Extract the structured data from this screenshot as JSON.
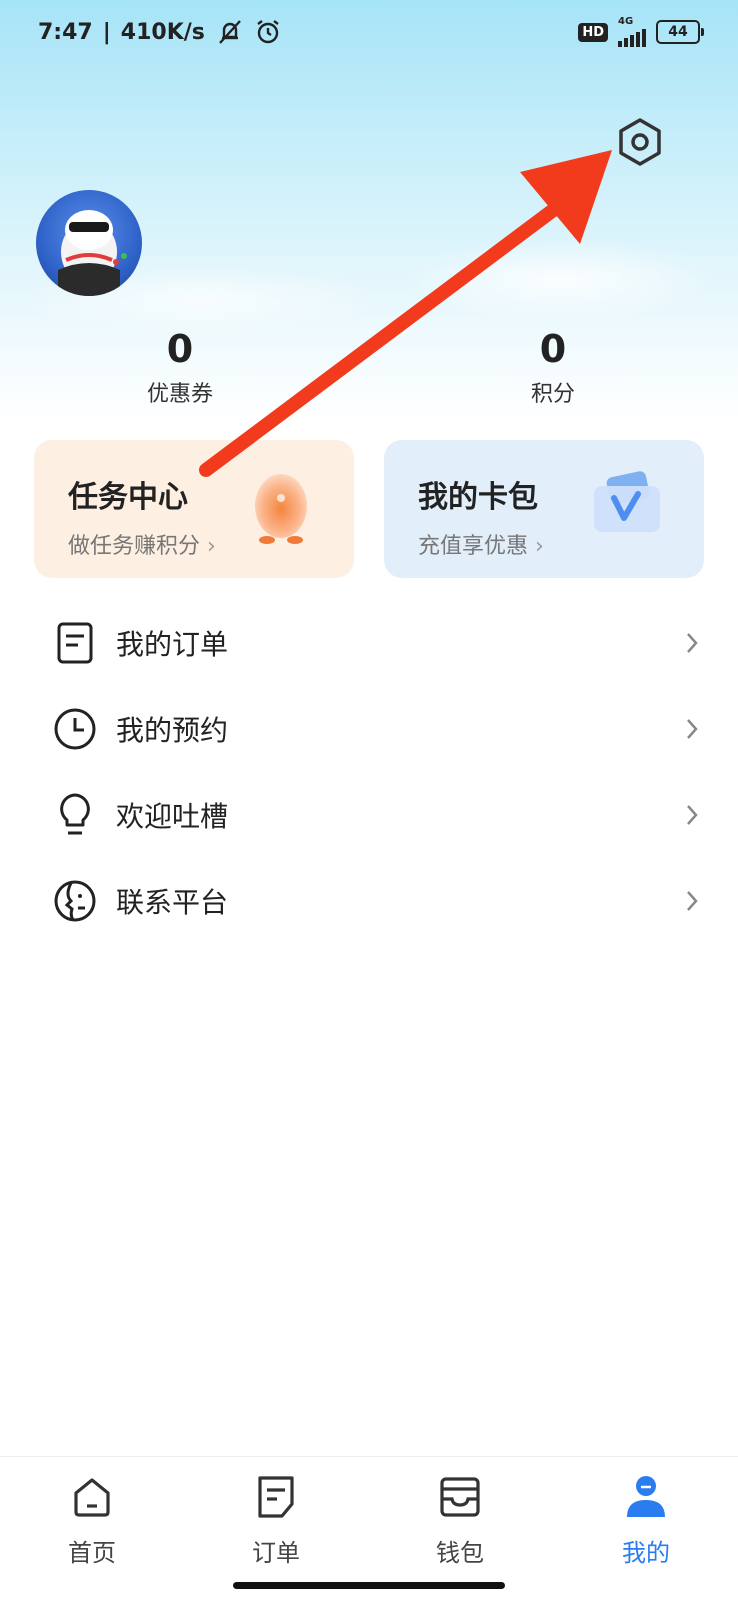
{
  "status_bar": {
    "time": "7:47",
    "speed": "410K/s",
    "hd": "HD",
    "network": "4G",
    "battery": "44"
  },
  "profile": {
    "settings_icon": "settings-hexagon-icon"
  },
  "stats": [
    {
      "value": "0",
      "label": "优惠券"
    },
    {
      "value": "0",
      "label": "积分"
    }
  ],
  "cards": {
    "task": {
      "title": "任务中心",
      "subtitle": "做任务赚积分"
    },
    "wallet": {
      "title": "我的卡包",
      "subtitle": "充值享优惠"
    }
  },
  "menu": [
    {
      "label": "我的订单",
      "icon": "order-doc-icon"
    },
    {
      "label": "我的预约",
      "icon": "clock-icon"
    },
    {
      "label": "欢迎吐槽",
      "icon": "lightbulb-icon"
    },
    {
      "label": "联系平台",
      "icon": "contact-face-icon"
    }
  ],
  "tabbar": [
    {
      "label": "首页",
      "icon": "home-icon"
    },
    {
      "label": "订单",
      "icon": "order-icon"
    },
    {
      "label": "钱包",
      "icon": "wallet-icon"
    },
    {
      "label": "我的",
      "icon": "profile-icon",
      "active": true
    }
  ],
  "colors": {
    "accent": "#2a7df0",
    "task_card_bg": "#fdf0e2",
    "wallet_card_bg": "#e3eefb",
    "annotation_arrow": "#f23a1c"
  }
}
